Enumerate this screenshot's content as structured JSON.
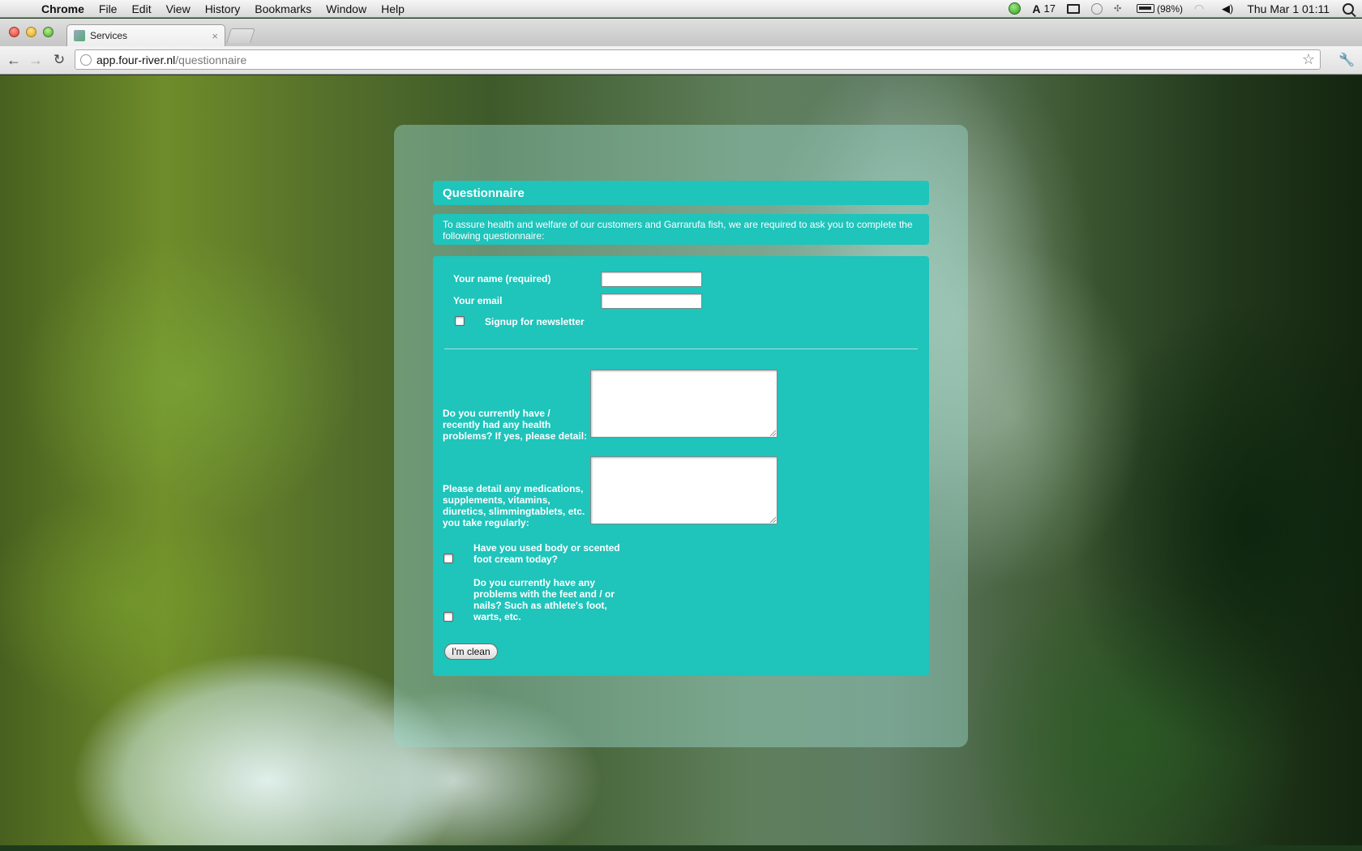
{
  "menubar": {
    "apple": "",
    "items": [
      "Chrome",
      "File",
      "Edit",
      "View",
      "History",
      "Bookmarks",
      "Window",
      "Help"
    ],
    "adobe_count": "17",
    "battery": "(98%)",
    "datetime": "Thu Mar 1  01:11"
  },
  "browser": {
    "tab_title": "Services",
    "tab_close": "×",
    "url_host": "app.four-river.nl",
    "url_path": "/questionnaire"
  },
  "form": {
    "title": "Questionnaire",
    "intro": "To assure health and welfare of our customers and Garrarufa fish, we are required to ask you to complete the following questionnaire:",
    "name_label": "Your name (required)",
    "name_value": "",
    "email_label": "Your email",
    "email_value": "",
    "newsletter_label": "Signup for newsletter",
    "health_label": "Do you currently have / recently had any health problems? If yes, please detail:",
    "health_value": "",
    "medication_label": "Please detail any medications, supplements, vitamins, diuretics, slimmingtablets, etc. you take regularly:",
    "medication_value": "",
    "cream_label": "Have you used body or scented foot cream today?",
    "feet_label": "Do you currently have any problems with the feet and / or nails? Such as athlete's foot, warts, etc.",
    "submit_label": "I'm clean"
  }
}
